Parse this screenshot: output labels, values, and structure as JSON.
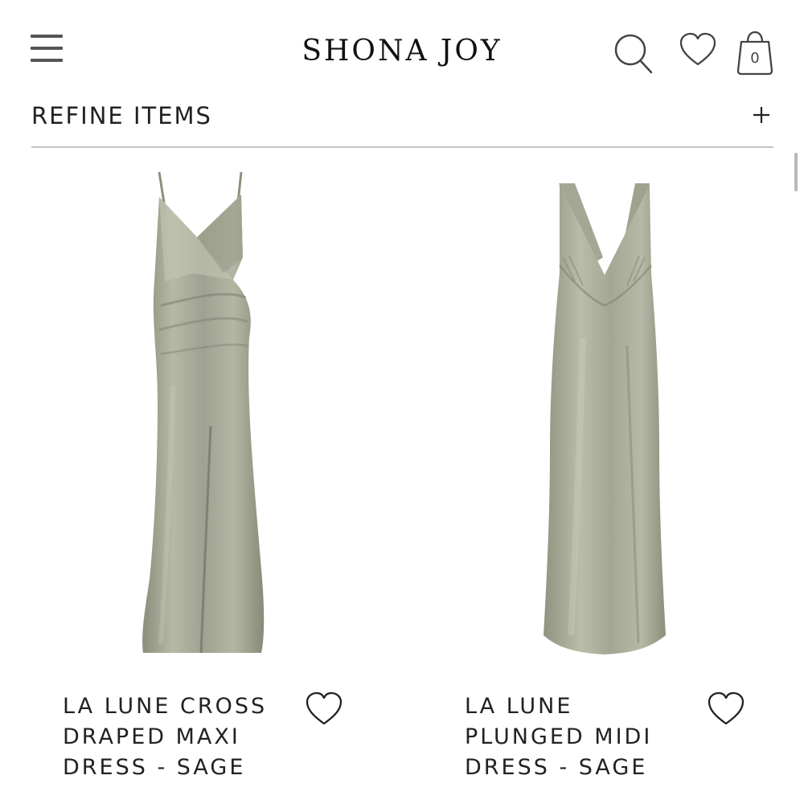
{
  "header": {
    "menu_icon": "hamburger-menu-icon",
    "logo_text": "SHONA JOY",
    "search_icon": "search-icon",
    "wishlist_icon": "heart-icon",
    "bag_icon": "shopping-bag-icon",
    "bag_count": "0"
  },
  "refine": {
    "label": "REFINE ITEMS",
    "toggle_icon": "plus-icon"
  },
  "products": [
    {
      "name": "LA LUNE CROSS DRAPED MAXI DRESS - SAGE",
      "image_icon": "sage-satin-maxi-dress-image",
      "wishlist_icon": "heart-icon"
    },
    {
      "name": "LA LUNE PLUNGED MIDI DRESS - SAGE",
      "image_icon": "sage-satin-midi-dress-image",
      "wishlist_icon": "heart-icon"
    }
  ],
  "colors": {
    "dress": "#a6a996",
    "dress_shadow": "#7f8470",
    "dress_highlight": "#c9ccbc",
    "divider": "#c4c4c4",
    "text": "#222222"
  }
}
